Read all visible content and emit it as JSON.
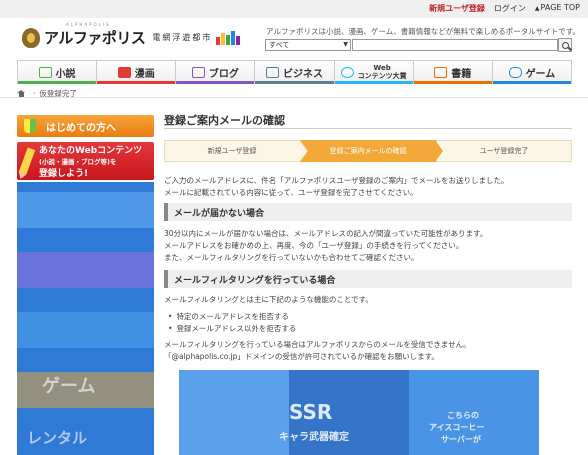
{
  "topbar": {
    "register_label": "新規ユーザ登録",
    "login_label": "ログイン",
    "pagetop_label": "PAGE TOP"
  },
  "header": {
    "logo_text": "アルファポリス",
    "logo_ruby": "ALPHAPOLIS",
    "logo_sub": "電網浮遊都市",
    "tagline": "アルファポリスは小説、漫画、ゲーム、書籍情報などが無料で楽しめるポータルサイトです。",
    "search_select": "すべて",
    "search_placeholder": ""
  },
  "nav": {
    "items": [
      {
        "label": "小説",
        "color": "#4caf50"
      },
      {
        "label": "漫画",
        "color": "#e53935"
      },
      {
        "label": "ブログ",
        "color": "#7e57c2"
      },
      {
        "label": "ビジネス",
        "color": "#607d8b"
      },
      {
        "label": "Web\nコンテンツ大賞",
        "color": "#29b6f6"
      },
      {
        "label": "書籍",
        "color": "#ef6c00"
      },
      {
        "label": "ゲーム",
        "color": "#1e88e5"
      }
    ]
  },
  "breadcrumb": {
    "current": "仮登録完了"
  },
  "sidebar": {
    "first_time_label": "はじめての方へ",
    "webcontent_line1": "あなたのWebコンテンツ",
    "webcontent_line2": "(小説・漫画・ブログ等)を",
    "webcontent_line3": "登録しよう!",
    "banner_words": [
      "ゲーム",
      "レンタル"
    ]
  },
  "main": {
    "title": "登録ご案内メールの確認",
    "steps": [
      "新規ユーザ登録",
      "登録ご案内メールの確認",
      "ユーザ登録完了"
    ],
    "intro_1": "ご入力のメールアドレスに、件名「アルファポリスユーザ登録のご案内」でメールをお送りしました。",
    "intro_2": "メールに記載されている内容に従って、ユーザ登録を完了させてください。",
    "section1_title": "メールが届かない場合",
    "section1_p1": "30分以内にメールが届かない場合は、メールアドレスの記入が間違っていた可能性があります。",
    "section1_p2": "メールアドレスをお確かめの上、再度、今の「ユーザ登録」の手続きを行ってください。",
    "section1_p3": "また、メールフィルタリングを行っていないかも合わせてご確認ください。",
    "section2_title": "メールフィルタリングを行っている場合",
    "section2_p1": "メールフィルタリングとは主に下記のような機能のことです。",
    "bullets": [
      "特定のメールアドレスを拒否する",
      "登録メールアドレス以外を拒否する"
    ],
    "section2_p2": "メールフィルタリングを行っている場合はアルファポリスからのメールを受信できません。",
    "section2_p3": "「@alphapolis.co.jp」ドメインの受信が許可されているか確認をお願いします。"
  },
  "ad": {
    "words": [
      "SSR",
      "キャラ武器確定",
      "こちらの",
      "アイスコーヒー",
      "サーバーが"
    ]
  },
  "colors": {
    "accent_orange": "#f3a83a",
    "accent_red": "#c8171e",
    "overlay_blue": "#2f7ad6"
  }
}
